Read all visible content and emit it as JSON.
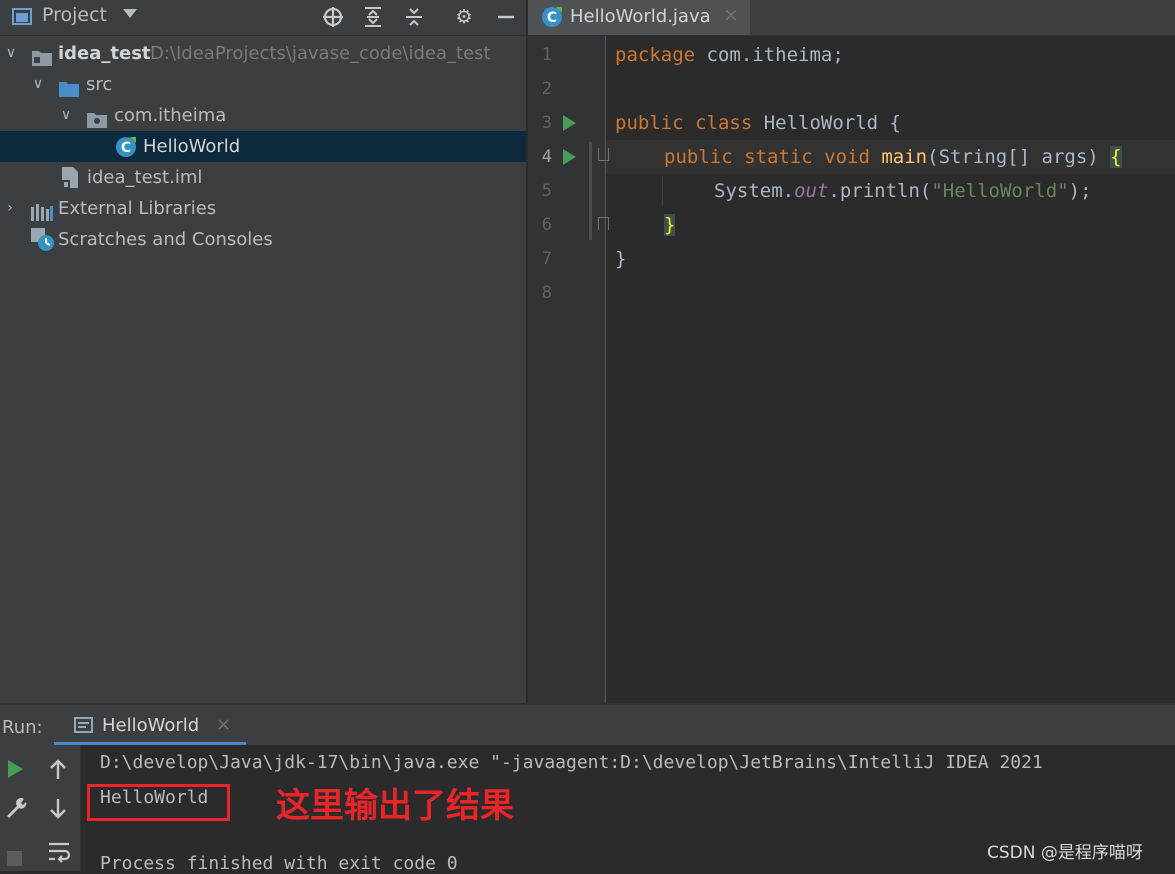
{
  "project_panel": {
    "title": "Project",
    "tree": [
      {
        "label": "idea_test",
        "path": "D:\\IdeaProjects\\javase_code\\idea_test"
      },
      {
        "label": "src"
      },
      {
        "label": "com.itheima"
      },
      {
        "label": "HelloWorld"
      },
      {
        "label": "idea_test.iml"
      },
      {
        "label": "External Libraries"
      },
      {
        "label": "Scratches and Consoles"
      }
    ]
  },
  "editor": {
    "tab_label": "HelloWorld.java",
    "tab_close": "×",
    "line_numbers": [
      "1",
      "2",
      "3",
      "4",
      "5",
      "6",
      "7",
      "8"
    ],
    "code": {
      "l1_kw": "package",
      "l1_rest": " com.itheima;",
      "l3_kw": "public class",
      "l3_rest": " HelloWorld {",
      "l4_kw": "public static void",
      "l4_fn": "main",
      "l4_rest": "(String[] args) ",
      "l4_brace": "{",
      "l5_a": "System.",
      "l5_field": "out",
      "l5_b": ".println(",
      "l5_str": "\"HelloWorld\"",
      "l5_c": ");",
      "l6_brace": "}",
      "l7": "}"
    }
  },
  "run_panel": {
    "label": "Run:",
    "tab_label": "HelloWorld",
    "tab_close": "×",
    "console_lines": [
      "D:\\develop\\Java\\jdk-17\\bin\\java.exe \"-javaagent:D:\\develop\\JetBrains\\IntelliJ IDEA 2021",
      "HelloWorld",
      "",
      "Process finished with exit code 0"
    ]
  },
  "annotation": {
    "text": "这里输出了结果",
    "color": "#e8262a"
  },
  "watermark": "CSDN @是程序喵呀",
  "colors": {
    "keyword": "#cc7832",
    "string": "#6a8759",
    "function": "#ffc66d",
    "field": "#9876aa",
    "selection": "#0d293e",
    "run_green": "#499c54",
    "tab_underline": "#4a88c7"
  },
  "icons": {
    "header": [
      "project-icon",
      "chevron-down-icon",
      "target-icon",
      "expand-all-icon",
      "collapse-all-icon",
      "gear-icon",
      "minimize-icon"
    ],
    "run_toolbar": [
      "run-icon",
      "up-arrow-icon",
      "wrench-icon",
      "down-arrow-icon",
      "stop-icon",
      "soft-wrap-icon"
    ]
  }
}
